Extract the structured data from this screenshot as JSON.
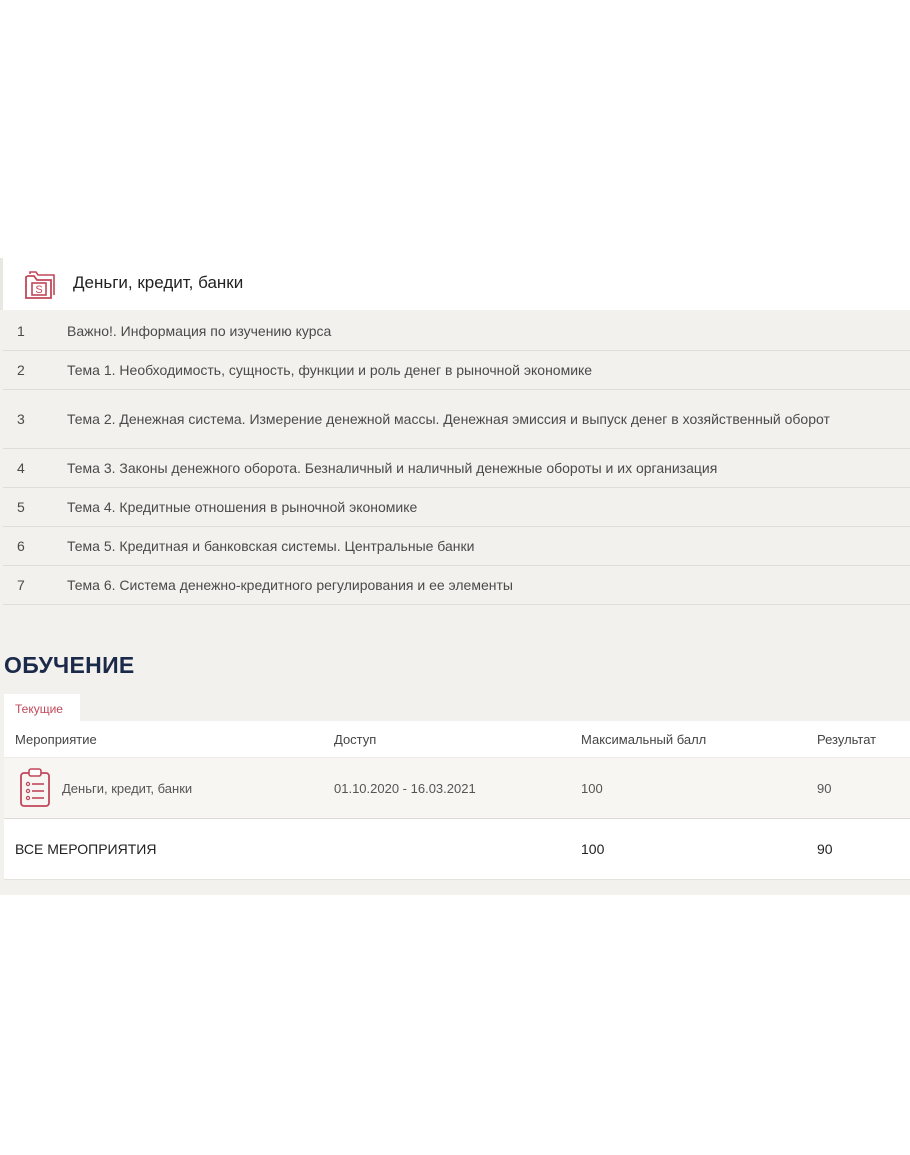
{
  "course": {
    "title": "Деньги, кредит, банки",
    "icon": "money-folder-icon",
    "topics": [
      {
        "num": "1",
        "text": "Важно!. Информация по изучению курса"
      },
      {
        "num": "2",
        "text": "Тема 1. Необходимость, сущность, функции и роль денег в рыночной экономике"
      },
      {
        "num": "3",
        "text": "Тема 2. Денежная система. Измерение денежной массы. Денежная эмиссия и выпуск денег в хозяйственный оборот"
      },
      {
        "num": "4",
        "text": "Тема 3. Законы денежного оборота. Безналичный и наличный денежные обороты и их организация"
      },
      {
        "num": "5",
        "text": "Тема 4. Кредитные отношения в рыночной экономике"
      },
      {
        "num": "6",
        "text": "Тема 5. Кредитная и банковская системы. Центральные банки"
      },
      {
        "num": "7",
        "text": "Тема 6. Система денежно-кредитного регулирования и ее элементы"
      }
    ]
  },
  "learning": {
    "section_title": "ОБУЧЕНИЕ",
    "tab_current": "Текущие",
    "headers": {
      "event": "Мероприятие",
      "access": "Доступ",
      "max_score": "Максимальный балл",
      "result": "Результат"
    },
    "rows": [
      {
        "icon": "clipboard-list-icon",
        "event": "Деньги, кредит, банки",
        "access": "01.10.2020 - 16.03.2021",
        "max_score": "100",
        "result": "90"
      }
    ],
    "total": {
      "label": "ВСЕ МЕРОПРИЯТИЯ",
      "max_score": "100",
      "result": "90"
    }
  },
  "colors": {
    "accent": "#c0475a",
    "title_navy": "#1c2a4a",
    "panel_bg": "#f2f1ee"
  }
}
